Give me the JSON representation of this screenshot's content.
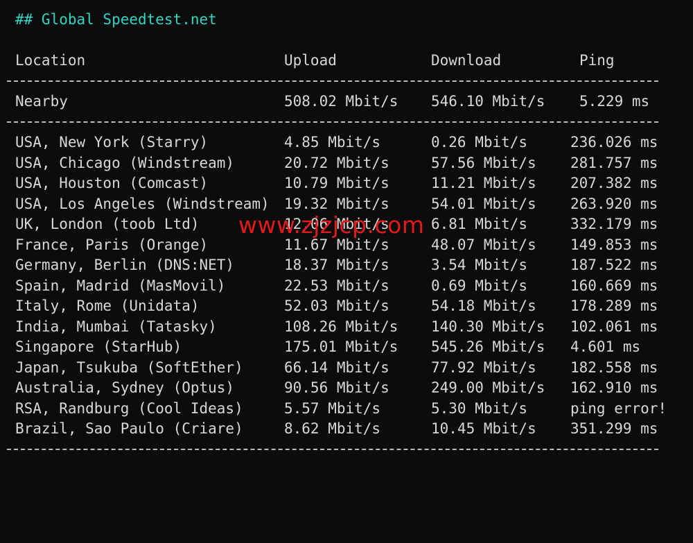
{
  "terminal": {
    "title": "## Global Speedtest.net",
    "headers": {
      "location": "Location",
      "upload": "Upload",
      "download": "Download",
      "ping": "Ping"
    },
    "nearby": {
      "location": "Nearby",
      "upload": "508.02 Mbit/s",
      "download": "546.10 Mbit/s",
      "ping": "5.229 ms"
    },
    "rows": [
      {
        "location": "USA, New York (Starry)",
        "upload": "4.85 Mbit/s",
        "download": "0.26 Mbit/s",
        "ping": "236.026 ms"
      },
      {
        "location": "USA, Chicago (Windstream)",
        "upload": "20.72 Mbit/s",
        "download": "57.56 Mbit/s",
        "ping": "281.757 ms"
      },
      {
        "location": "USA, Houston (Comcast)",
        "upload": "10.79 Mbit/s",
        "download": "11.21 Mbit/s",
        "ping": "207.382 ms"
      },
      {
        "location": "USA, Los Angeles (Windstream)",
        "upload": "19.32 Mbit/s",
        "download": "54.01 Mbit/s",
        "ping": "263.920 ms"
      },
      {
        "location": "UK, London (toob Ltd)",
        "upload": "12.06 Mbit/s",
        "download": "6.81 Mbit/s",
        "ping": "332.179 ms"
      },
      {
        "location": "France, Paris (Orange)",
        "upload": "11.67 Mbit/s",
        "download": "48.07 Mbit/s",
        "ping": "149.853 ms"
      },
      {
        "location": "Germany, Berlin (DNS:NET)",
        "upload": "18.37 Mbit/s",
        "download": "3.54 Mbit/s",
        "ping": "187.522 ms"
      },
      {
        "location": "Spain, Madrid (MasMovil)",
        "upload": "22.53 Mbit/s",
        "download": "0.69 Mbit/s",
        "ping": "160.669 ms"
      },
      {
        "location": "Italy, Rome (Unidata)",
        "upload": "52.03 Mbit/s",
        "download": "54.18 Mbit/s",
        "ping": "178.289 ms"
      },
      {
        "location": "India, Mumbai (Tatasky)",
        "upload": "108.26 Mbit/s",
        "download": "140.30 Mbit/s",
        "ping": "102.061 ms"
      },
      {
        "location": "Singapore (StarHub)",
        "upload": "175.01 Mbit/s",
        "download": "545.26 Mbit/s",
        "ping": "4.601 ms"
      },
      {
        "location": "Japan, Tsukuba (SoftEther)",
        "upload": "66.14 Mbit/s",
        "download": "77.92 Mbit/s",
        "ping": "182.558 ms"
      },
      {
        "location": "Australia, Sydney (Optus)",
        "upload": "90.56 Mbit/s",
        "download": "249.00 Mbit/s",
        "ping": "162.910 ms"
      },
      {
        "location": "RSA, Randburg (Cool Ideas)",
        "upload": "5.57 Mbit/s",
        "download": "5.30 Mbit/s",
        "ping": "ping error!"
      },
      {
        "location": "Brazil, Sao Paulo (Criare)",
        "upload": "8.62 Mbit/s",
        "download": "10.45 Mbit/s",
        "ping": "351.299 ms"
      }
    ],
    "watermark": "www.zjzjcp.com"
  },
  "colors": {
    "background": "#0c0c0c",
    "text": "#d8d8d8",
    "title": "#2fd6c6",
    "watermark": "#e11b1b"
  }
}
